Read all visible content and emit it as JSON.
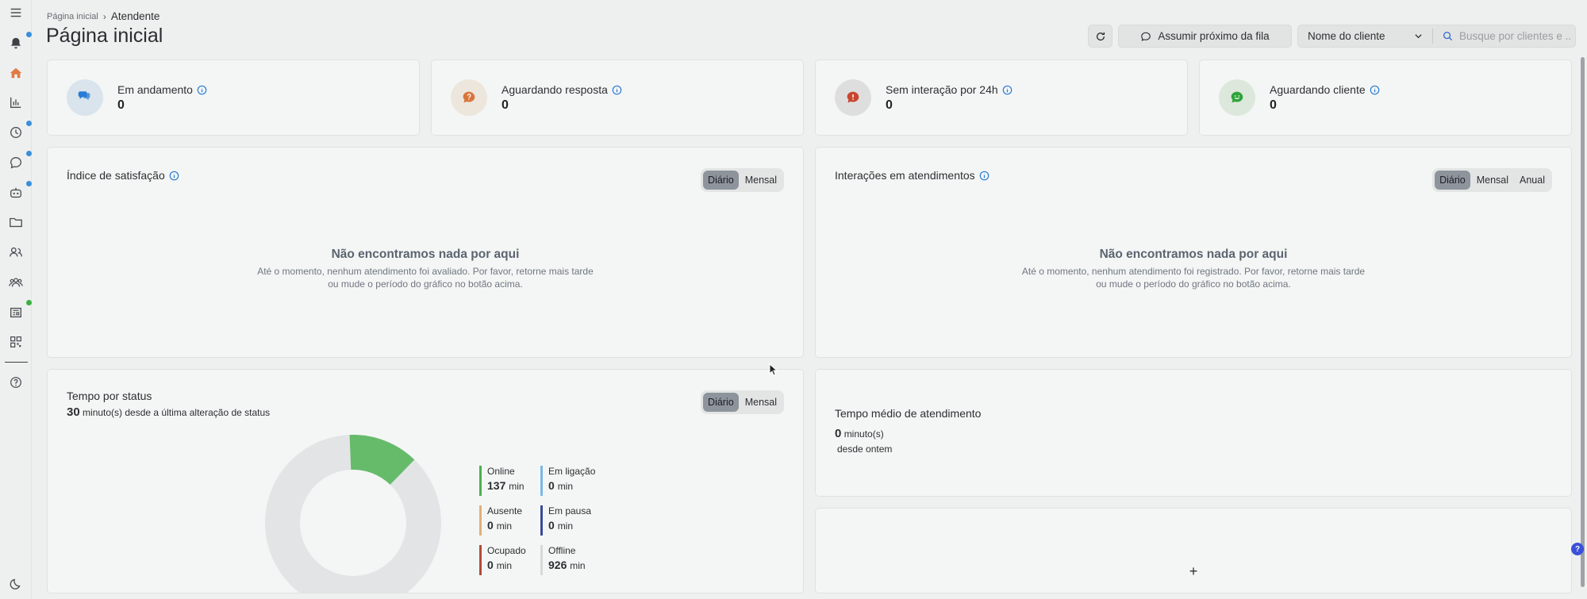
{
  "breadcrumb": {
    "home": "Página inicial",
    "current": "Atendente"
  },
  "page_title": "Página inicial",
  "actions": {
    "next_in_queue": "Assumir próximo da fila",
    "filter_select": "Nome do cliente",
    "search_placeholder": "Busque por clientes e ..."
  },
  "stats": [
    {
      "label": "Em andamento",
      "value": "0",
      "icon": "chat-bubbles-icon",
      "color": "#2a7bd6",
      "bg": "#d9e4ec"
    },
    {
      "label": "Aguardando resposta",
      "value": "0",
      "icon": "question-bubble-icon",
      "color": "#d8753a",
      "bg": "#ece6dc"
    },
    {
      "label": "Sem interação por 24h",
      "value": "0",
      "icon": "alert-bubble-icon",
      "color": "#c9452e",
      "bg": "#dedede"
    },
    {
      "label": "Aguardando cliente",
      "value": "0",
      "icon": "smile-bubble-icon",
      "color": "#2fa43a",
      "bg": "#dde8dd"
    }
  ],
  "satisfaction": {
    "title": "Índice de satisfação",
    "toggle": [
      "Diário",
      "Mensal"
    ],
    "empty_title": "Não encontramos nada por aqui",
    "empty_text": "Até o momento, nenhum atendimento foi avaliado. Por favor, retorne mais tarde ou mude o período do gráfico no botão acima."
  },
  "interactions": {
    "title": "Interações em atendimentos",
    "toggle": [
      "Diário",
      "Mensal",
      "Anual"
    ],
    "empty_title": "Não encontramos nada por aqui",
    "empty_text": "Até o momento, nenhum atendimento foi registrado. Por favor, retorne mais tarde ou mude o período do gráfico no botão acima."
  },
  "status_time": {
    "title": "Tempo por status",
    "minutes": "30",
    "subtitle": "minuto(s) desde a última alteração de status",
    "toggle": [
      "Diário",
      "Mensal"
    ],
    "unit": "min",
    "legend": [
      {
        "name": "Online",
        "value": "137",
        "color": "#4caf50"
      },
      {
        "name": "Em ligação",
        "value": "0",
        "color": "#7ab8e6"
      },
      {
        "name": "Ausente",
        "value": "0",
        "color": "#e0b07a"
      },
      {
        "name": "Em pausa",
        "value": "0",
        "color": "#3a4a9a"
      },
      {
        "name": "Ocupado",
        "value": "0",
        "color": "#b5493a"
      },
      {
        "name": "Offline",
        "value": "926",
        "color": "#d6d8da"
      }
    ],
    "donut": {
      "online_share": 0.129,
      "online_color": "#66bb6a",
      "offline_color": "#e3e4e6"
    }
  },
  "avg_time": {
    "title": "Tempo médio de atendimento",
    "value": "0",
    "unit": "minuto(s)",
    "since": "desde ontem"
  },
  "add_widget": "+"
}
